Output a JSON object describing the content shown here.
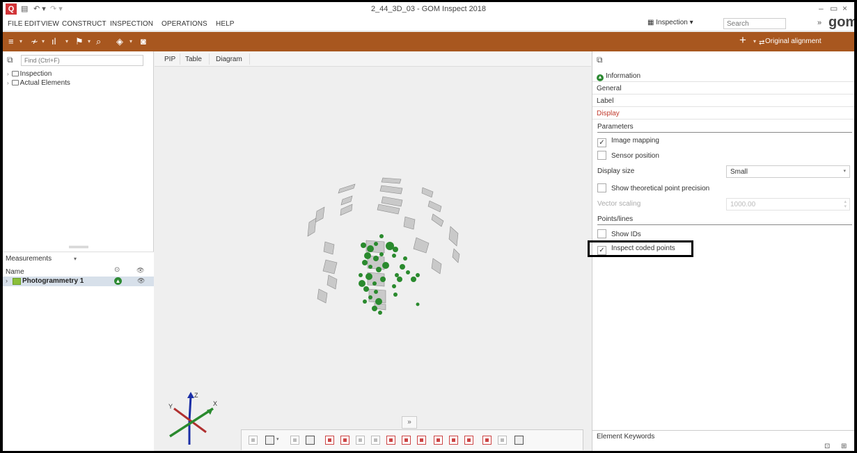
{
  "window": {
    "title": "2_44_3D_03 - GOM Inspect 2018",
    "minimize": "–",
    "restore": "▭",
    "close": "×"
  },
  "menu": {
    "items": [
      "FILE",
      "EDIT",
      "VIEW",
      "CONSTRUCT",
      "INSPECTION",
      "OPERATIONS",
      "HELP"
    ],
    "workspace_label": "Inspection",
    "search_placeholder": "Search",
    "logo": "gom"
  },
  "toolbar": {
    "alignment_label": "Original alignment"
  },
  "explorer": {
    "find_placeholder": "Find (Ctrl+F)",
    "tree": [
      "Inspection",
      "Actual Elements"
    ]
  },
  "measurements": {
    "header": "Measurements",
    "column_name": "Name",
    "rows": [
      {
        "label": "Photogrammetry 1"
      }
    ]
  },
  "view": {
    "tabs": [
      "PIP",
      "Table",
      "Diagram"
    ],
    "axes": {
      "x": "X",
      "y": "Y",
      "z": "Z"
    }
  },
  "properties": {
    "sections": {
      "information": "Information",
      "general": "General",
      "label": "Label",
      "display": "Display"
    },
    "parameters_header": "Parameters",
    "image_mapping": "Image mapping",
    "sensor_position": "Sensor position",
    "display_size_label": "Display size",
    "display_size_value": "Small",
    "show_theoretical": "Show theoretical point precision",
    "vector_scaling_label": "Vector scaling",
    "vector_scaling_value": "1000.00",
    "points_lines_header": "Points/lines",
    "show_ids": "Show IDs",
    "inspect_coded_points": "Inspect coded points",
    "element_keywords": "Element Keywords"
  },
  "state": {
    "image_mapping_checked": true,
    "sensor_position_checked": false,
    "show_theoretical_checked": false,
    "show_ids_checked": false,
    "inspect_coded_points_checked": true
  },
  "colors": {
    "toolbar": "#a8571f",
    "active_section": "#c0392b",
    "points": "#2a8a2e"
  }
}
